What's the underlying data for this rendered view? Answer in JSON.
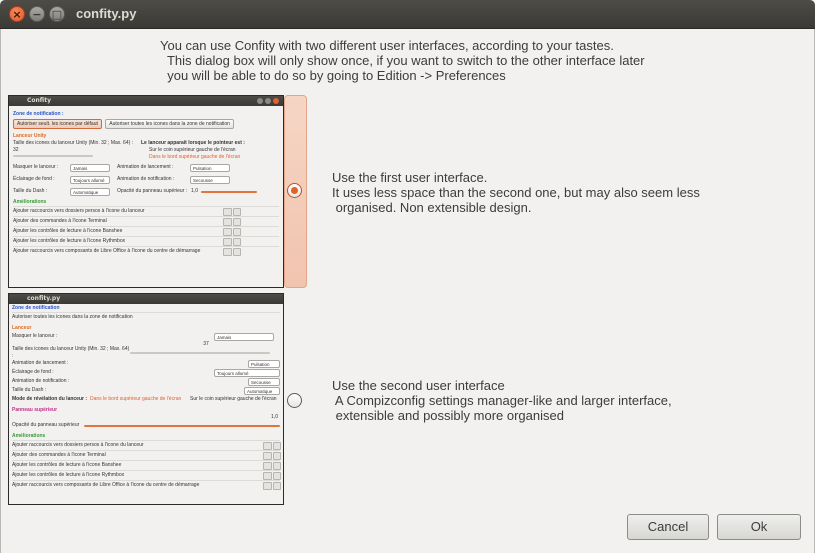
{
  "window": {
    "title": "confity.py",
    "close_glyph": "×",
    "minimize_glyph": "−",
    "maximize_glyph": "□"
  },
  "intro_text": "You can use Confity with two different user interfaces, according to your tastes.\n  This dialog box will only show once, if you want to switch to the other interface later\n  you will be able to do so by going to Edition -> Preferences",
  "option1": {
    "selected": true,
    "description": "Use the first user interface.\nIt uses less space than the second one, but may also seem less\n organised. Non extensible design.",
    "preview": {
      "title": "Confity",
      "notif_section": "Zone de notification :",
      "btn_a": "Autoriser seult. les icones par défaut",
      "btn_b": "Autoriser toutes les icones dans la zone de notification",
      "launcher_section": "Lanceur Unity",
      "size_label": "Taille des icones du lanceur Unity (Min. 32 ; Max. 64) :",
      "size_value": "32",
      "appear_label": "Le lanceur apparait lorsque le pointeur est :",
      "appear_opt1": "Sur le coin supérieur gauche de l'écran",
      "appear_opt2": "Dans le bord supérieur gauche de l'écran",
      "hide_label": "Masquer le lanceur :",
      "hide_value": "Jamais",
      "anim_label": "Animation de lancement :",
      "anim_value": "Pulsation",
      "bg_label": "Éclairage de fond :",
      "bg_value": "Toujours allumé",
      "notifanim_label": "Animation de notification :",
      "notifanim_value": "Secousse",
      "dash_label": "Taille du Dash :",
      "dash_value": "Automatique",
      "opacity_label": "Opacité du panneau supérieur :",
      "opacity_value": "1,0",
      "improve_section": "Améliorations",
      "items": [
        "Ajouter raccourcis vers dossiers persos à l'icone du lanceur",
        "Ajouter des commandes à l'icone Terminal",
        "Ajouter les contrôles de lecture à l'icone Banshee",
        "Ajouter les contrôles de lecture à l'icone Rythmbox",
        "Ajouter raccourcis vers composants de Libre Office à l'icone du centre de démarrage"
      ]
    }
  },
  "option2": {
    "selected": false,
    "description": "Use the second user interface\n A Compizconfig settings manager-like and larger interface,\n extensible and possibly more organised",
    "preview": {
      "title": "confity.py",
      "notif_section": "Zone de notification",
      "notif_item": "Autoriser toutes les icones dans la zone de notification",
      "launcher_section": "Lanceur",
      "hide_label": "Masquer le lanceur :",
      "hide_value": "Jamais",
      "size_label": "Taille des icones du lanceur Unity (Min. 32 ; Max. 64) :",
      "size_value": "37",
      "anim_label": "Animation de lancement :",
      "anim_value": "Pulsation",
      "bg_label": "Éclairage de fond :",
      "bg_value": "Toujours allumé",
      "notifanim_label": "Animation de notification :",
      "notifanim_value": "Secousse",
      "dash_label": "Taille du Dash :",
      "dash_value": "Automatique",
      "reveal_label": "Mode de révélation du lanceur :",
      "reveal_opt1": "Dans le bord supérieur gauche de l'écran",
      "reveal_opt2": "Sur le coin supérieur gauche de l'écran",
      "panel_section": "Panneau supérieur",
      "opacity_label": "Opacité du panneau supérieur",
      "opacity_value": "1,0",
      "improve_section": "Améliorations",
      "items": [
        "Ajouter raccourcis vers dossiers persos à l'icone du lanceur",
        "Ajouter des commandes à l'icone Terminal",
        "Ajouter les contrôles de lecture à l'icone Banshee",
        "Ajouter les contrôles de lecture à l'icone Rythmbox",
        "Ajouter raccourcis vers composants de Libre Office à l'icone du centre de démarrage"
      ]
    }
  },
  "buttons": {
    "cancel": "Cancel",
    "ok": "Ok"
  },
  "colors": {
    "accent": "#e0612b",
    "selection_bg": "#f1c4ae"
  }
}
